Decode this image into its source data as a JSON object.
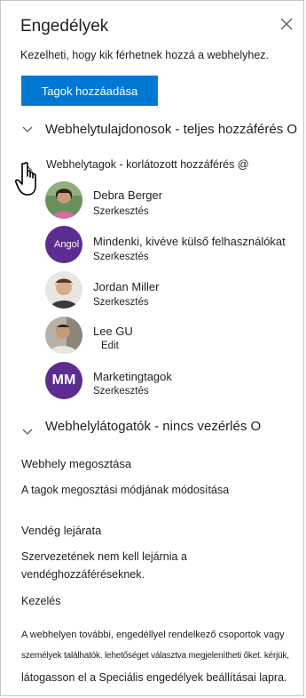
{
  "panel": {
    "title": "Engedélyek",
    "subtitle": "Kezelheti, hogy kik férhetnek hozzá a webhelyhez.",
    "add_members_label": "Tagok hozzáadása"
  },
  "groups": {
    "owners_label": "Webhelytulajdonosok - teljes hozzáférés O",
    "members_label": "Webhelytagok - korlátozott hozzáférés @",
    "visitors_label": "Webhelylátogatók - nincs vezérlés O"
  },
  "members": [
    {
      "name": "Debra Berger",
      "role": "Szerkesztés",
      "avatar": "photo-debra"
    },
    {
      "name": "Mindenki, kivéve külső felhasználókat",
      "role": "Szerkesztés",
      "avatar_text": "Angol"
    },
    {
      "name": "Jordan Miller",
      "role": "Szerkesztés",
      "avatar": "photo-jordan"
    },
    {
      "name": "Lee GU",
      "role": "Edit",
      "avatar": "photo-lee"
    },
    {
      "name": "Marketingtagok",
      "role": "Szerkesztés",
      "avatar_text": "MM"
    }
  ],
  "sharing": {
    "title": "Webhely megosztása",
    "link": "A tagok megosztási módjának módosítása"
  },
  "guest_expiry": {
    "title": "Vendég lejárata",
    "line1": "Szervezetének nem kell lejárnia a",
    "line2": "vendéghozzáféréseknek.",
    "manage": "Kezelés"
  },
  "footer": {
    "line1": "A webhelyen további, engedéllyel rendelkező csoportok vagy",
    "line2": "személyek találhatók. lehetőséget választva megjelenítheti őket. kérjük,",
    "line3": "látogasson el a Speciális engedélyek beállításai lapra."
  },
  "colors": {
    "accent": "#0078d4",
    "avatar_purple": "#5c2d91"
  }
}
